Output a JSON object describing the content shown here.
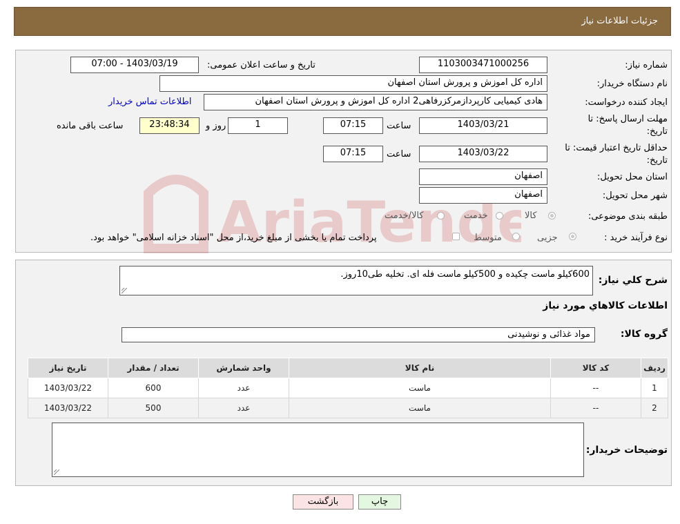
{
  "header": {
    "title": "جزئیات اطلاعات نیاز"
  },
  "form": {
    "need_number": {
      "label": "شماره نیاز:",
      "value": "1103003471000256"
    },
    "announce_datetime": {
      "label": "تاریخ و ساعت اعلان عمومی:",
      "value": "1403/03/19 - 07:00"
    },
    "buyer_org": {
      "label": "نام دستگاه خریدار:",
      "value": "اداره کل اموزش و پرورش استان اصفهان"
    },
    "requester": {
      "label": "ایجاد کننده درخواست:",
      "value": "هادی کیمیایی کارپردازمرکزرفاهی2 اداره کل اموزش و پرورش استان اصفهان"
    },
    "contact_link": "اطلاعات تماس خریدار",
    "reply_deadline": {
      "label_line1": "مهلت ارسال پاسخ: تا",
      "label_line2": "تاریخ:",
      "date": "1403/03/21",
      "time_label": "ساعت",
      "time": "07:15",
      "days": "1",
      "days_label": "روز و",
      "remaining": "23:48:34",
      "remaining_label": "ساعت باقی مانده"
    },
    "price_validity": {
      "label_line1": "حداقل تاریخ اعتبار قیمت: تا",
      "label_line2": "تاریخ:",
      "date": "1403/03/22",
      "time_label": "ساعت",
      "time": "07:15"
    },
    "delivery_province": {
      "label": "استان محل تحویل:",
      "value": "اصفهان"
    },
    "delivery_city": {
      "label": "شهر محل تحویل:",
      "value": "اصفهان"
    },
    "category": {
      "label": "طبقه بندی موضوعی:",
      "options": [
        "کالا",
        "خدمت",
        "کالا/خدمت"
      ]
    },
    "purchase_process": {
      "label": "نوع فرآیند خرید :",
      "options": [
        "جزیی",
        "متوسط"
      ],
      "note": "پرداخت تمام یا بخشی از مبلغ خرید،از محل \"اسناد خزانه اسلامی\" خواهد بود."
    }
  },
  "details": {
    "summary_label": "شرح کلي نياز:",
    "summary_value": "600کیلو ماست چکیده و 500کیلو ماست فله ای. تخلیه طی10روز.",
    "goods_info_title": "اطلاعات کالاهاي مورد نياز",
    "goods_group_label": "گروه کالا:",
    "goods_group_value": "مواد غذائی و نوشیدنی",
    "table": {
      "columns": [
        "رديف",
        "کد کالا",
        "نام کالا",
        "واحد شمارش",
        "تعداد / مقدار",
        "تاریخ نیاز"
      ],
      "rows": [
        [
          "1",
          "--",
          "ماست",
          "عدد",
          "600",
          "1403/03/22"
        ],
        [
          "2",
          "--",
          "ماست",
          "عدد",
          "500",
          "1403/03/22"
        ]
      ]
    },
    "buyer_notes_label": "توضیحات خریدار:",
    "buyer_notes_value": ""
  },
  "buttons": {
    "print": "چاپ",
    "back": "بازگشت"
  },
  "watermark": {
    "text": "AriaTender.neT"
  },
  "colors": {
    "header_bg": "#8a6a3f",
    "panel_bg": "#f2f2f2",
    "link": "#0000cc",
    "back_btn": "#fde4e4",
    "print_btn": "#e4f7e0"
  }
}
